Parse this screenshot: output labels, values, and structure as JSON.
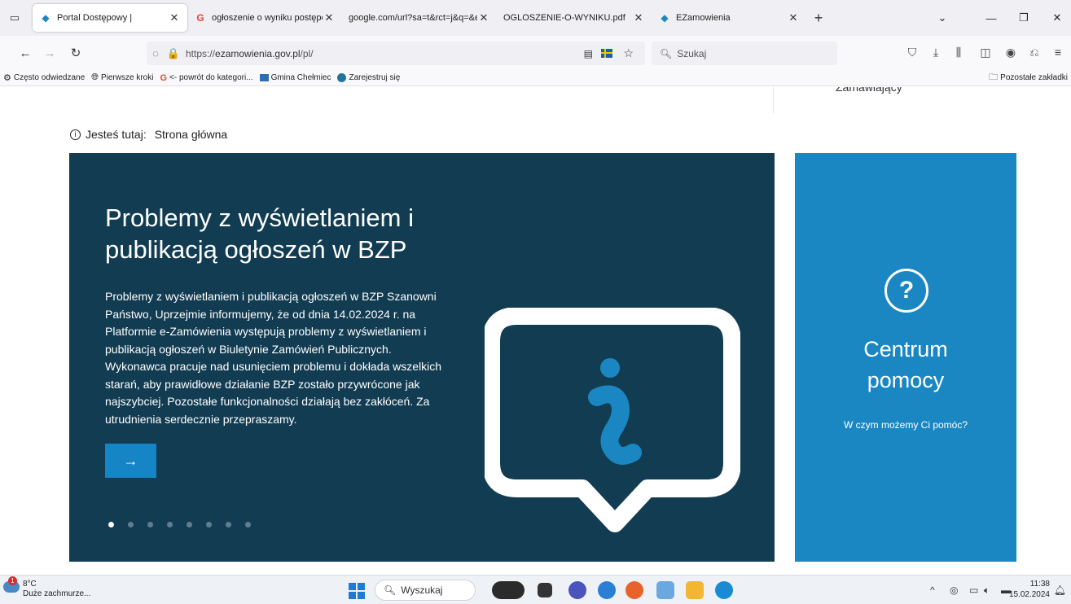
{
  "browser": {
    "tabs": [
      {
        "title": "Portal Dostępowy |",
        "icon": "ezamowienia-favicon",
        "active": true
      },
      {
        "title": "ogłoszenie o wyniku postępow",
        "icon": "google-favicon",
        "active": false
      },
      {
        "title": "google.com/url?sa=t&rct=j&q=&e",
        "icon": "none",
        "active": false
      },
      {
        "title": "OGLOSZENIE-O-WYNIKU.pdf",
        "icon": "none",
        "active": false
      },
      {
        "title": "EZamowienia",
        "icon": "ezamowienia-favicon",
        "active": false
      }
    ],
    "url_protocol": "https://",
    "url_host": "ezamowienia.gov.pl",
    "url_path": "/pl/",
    "search_placeholder": "Szukaj",
    "bookmarks": [
      {
        "label": "Często odwiedzane",
        "icon": "gear-icon"
      },
      {
        "label": "Pierwsze kroki",
        "icon": "globe-icon"
      },
      {
        "label": "<- powrót do kategori...",
        "icon": "google-icon"
      },
      {
        "label": "Gmina Chełmiec",
        "icon": "site-icon"
      },
      {
        "label": "Zarejestruj się",
        "icon": "wordpress-icon"
      }
    ],
    "other_bookmarks": "Pozostałe zakładki"
  },
  "page": {
    "cut_text": "Zamawiający",
    "breadcrumb_label": "Jesteś tutaj:",
    "breadcrumb_current": "Strona główna",
    "banner": {
      "title": "Problemy z wyświetlaniem i publikacją ogłoszeń w BZP",
      "body": "Problemy z wyświetlaniem i publikacją ogłoszeń w BZP Szanowni Państwo, Uprzejmie informujemy, że od dnia 14.02.2024 r. na Platformie e-Zamówienia występują problemy z wyświetlaniem i publikacją ogłoszeń w Biuletynie Zamówień Publicznych. Wykonawca pracuje nad usunięciem problemu i dokłada wszelkich starań, aby prawidłowe działanie BZP zostało przywrócone jak najszybciej. Pozostałe funkcjonalności działają bez zakłóceń. Za utrudnienia serdecznie przepraszamy.",
      "next_arrow": "→",
      "slide_count": 8,
      "active_slide": 1,
      "bg_color": "#123c52",
      "accent_color": "#1585c5"
    },
    "help": {
      "title_line1": "Centrum",
      "title_line2": "pomocy",
      "subtitle": "W czym możemy Ci pomóc?",
      "icon_glyph": "?",
      "bg_color": "#1a87c3"
    }
  },
  "taskbar": {
    "temperature": "8°C",
    "weather": "Duże zachmurze...",
    "weather_badge": "1",
    "search": "Wyszukaj",
    "time": "11:38",
    "date": "15.02.2024"
  }
}
